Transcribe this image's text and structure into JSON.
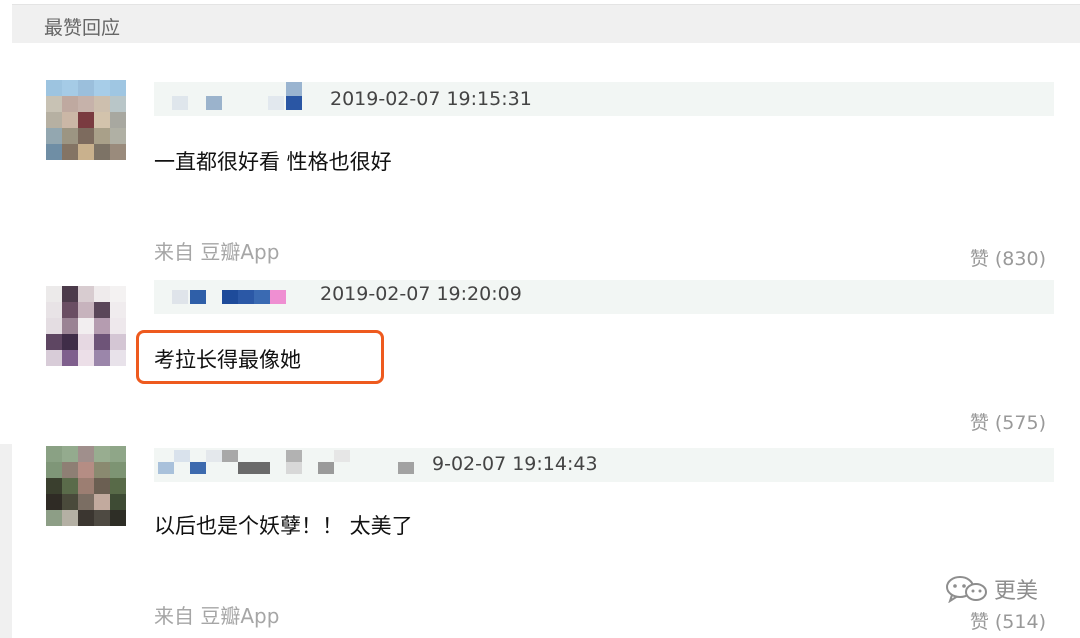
{
  "header": {
    "title": "最赞回应"
  },
  "comments": [
    {
      "time": "2019-02-07 19:15:31",
      "text": "一直都很好看 性格也很好",
      "source": "来自 豆瓣App",
      "likes": "赞 (830)"
    },
    {
      "time": "2019-02-07 19:20:09",
      "text": "考拉长得最像她",
      "source": "",
      "likes": "赞 (575)"
    },
    {
      "time": "9-02-07 19:14:43",
      "text": "以后也是个妖孽！！ 太美了",
      "source": "来自 豆瓣App",
      "likes": "赞 (514)"
    }
  ],
  "watermark": {
    "text": "更美",
    "icon": "wechat-icon"
  },
  "colors": {
    "highlight": "#ee5a1e",
    "header_bg": "#f0f0f0",
    "meta_bg": "#f2f6f4"
  }
}
